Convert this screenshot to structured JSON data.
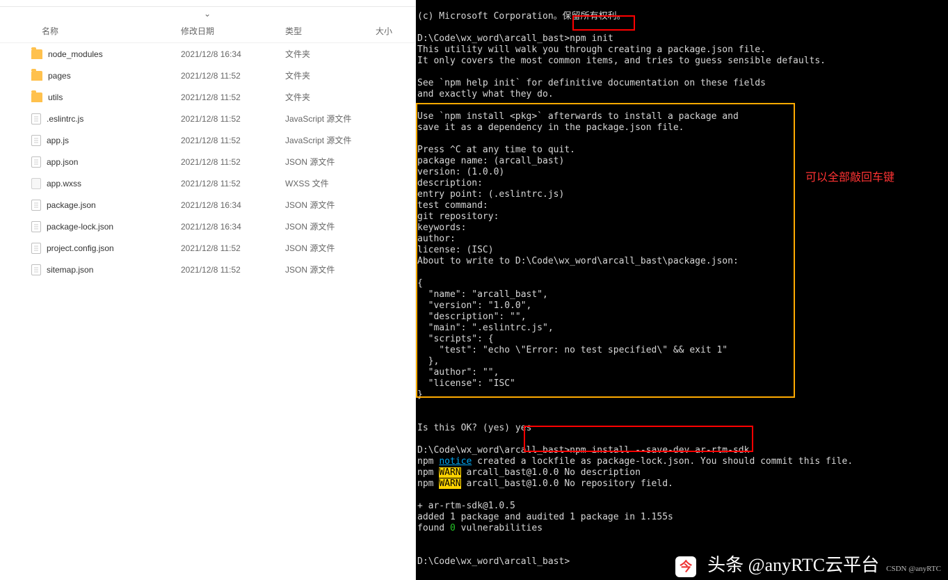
{
  "file_explorer": {
    "headers": {
      "name": "名称",
      "date": "修改日期",
      "type": "类型",
      "size": "大小"
    },
    "chevron": "⌃",
    "rows": [
      {
        "icon": "folder",
        "name": "node_modules",
        "date": "2021/12/8 16:34",
        "type": "文件夹"
      },
      {
        "icon": "folder",
        "name": "pages",
        "date": "2021/12/8 11:52",
        "type": "文件夹"
      },
      {
        "icon": "folder",
        "name": "utils",
        "date": "2021/12/8 11:52",
        "type": "文件夹"
      },
      {
        "icon": "jsfile",
        "name": ".eslintrc.js",
        "date": "2021/12/8 11:52",
        "type": "JavaScript 源文件"
      },
      {
        "icon": "jsfile",
        "name": "app.js",
        "date": "2021/12/8 11:52",
        "type": "JavaScript 源文件"
      },
      {
        "icon": "jsonfile",
        "name": "app.json",
        "date": "2021/12/8 11:52",
        "type": "JSON 源文件"
      },
      {
        "icon": "wxssfile",
        "name": "app.wxss",
        "date": "2021/12/8 11:52",
        "type": "WXSS 文件"
      },
      {
        "icon": "jsonfile",
        "name": "package.json",
        "date": "2021/12/8 16:34",
        "type": "JSON 源文件"
      },
      {
        "icon": "jsonfile",
        "name": "package-lock.json",
        "date": "2021/12/8 16:34",
        "type": "JSON 源文件"
      },
      {
        "icon": "jsonfile",
        "name": "project.config.json",
        "date": "2021/12/8 11:52",
        "type": "JSON 源文件"
      },
      {
        "icon": "jsonfile",
        "name": "sitemap.json",
        "date": "2021/12/8 11:52",
        "type": "JSON 源文件"
      }
    ]
  },
  "terminal": {
    "copyright": "(c) Microsoft Corporation。保留所有权利。",
    "blank": "",
    "prompt1_path": "D:\\Code\\wx_word\\arcall_bast>",
    "prompt1_cmd": "npm init",
    "l1": "This utility will walk you through creating a package.json file.",
    "l2": "It only covers the most common items, and tries to guess sensible defaults.",
    "l3": "See `npm help init` for definitive documentation on these fields",
    "l4": "and exactly what they do.",
    "l5": "Use `npm install <pkg>` afterwards to install a package and",
    "l6": "save it as a dependency in the package.json file.",
    "l7": "Press ^C at any time to quit.",
    "l8": "package name: (arcall_bast)",
    "l9": "version: (1.0.0)",
    "l10": "description:",
    "l11": "entry point: (.eslintrc.js)",
    "l12": "test command:",
    "l13": "git repository:",
    "l14": "keywords:",
    "l15": "author:",
    "l16": "license: (ISC)",
    "l17": "About to write to D:\\Code\\wx_word\\arcall_bast\\package.json:",
    "j0": "{",
    "j1": "  \"name\": \"arcall_bast\",",
    "j2": "  \"version\": \"1.0.0\",",
    "j3": "  \"description\": \"\",",
    "j4": "  \"main\": \".eslintrc.js\",",
    "j5": "  \"scripts\": {",
    "j6": "    \"test\": \"echo \\\"Error: no test specified\\\" && exit 1\"",
    "j7": "  },",
    "j8": "  \"author\": \"\",",
    "j9": "  \"license\": \"ISC\"",
    "j10": "}",
    "ok": "Is this OK? (yes) yes",
    "prompt2_path": "D:\\Code\\wx_word\\arcall_bast>",
    "prompt2_cmd": "npm install --save-dev ar-rtm-sdk",
    "npm1_a": "npm ",
    "npm1_b": "notice",
    "npm1_c": " created a lockfile as package-lock.json. You should commit this file.",
    "npm2_a": "npm ",
    "npm2_b": "WARN",
    "npm2_c": " arcall_bast@1.0.0 No description",
    "npm3_a": "npm ",
    "npm3_b": "WARN",
    "npm3_c": " arcall_bast@1.0.0 No repository field.",
    "r1": "+ ar-rtm-sdk@1.0.5",
    "r2": "added 1 package and audited 1 package in 1.155s",
    "r3_a": "found ",
    "r3_b": "0",
    "r3_c": " vulnerabilities",
    "prompt3": "D:\\Code\\wx_word\\arcall_bast>"
  },
  "annotation": {
    "text": "可以全部敲回车键"
  },
  "watermark": {
    "main": "头条 @anyRTC云平台",
    "sub": "CSDN @anyRTC",
    "icon_glyph": "今"
  }
}
